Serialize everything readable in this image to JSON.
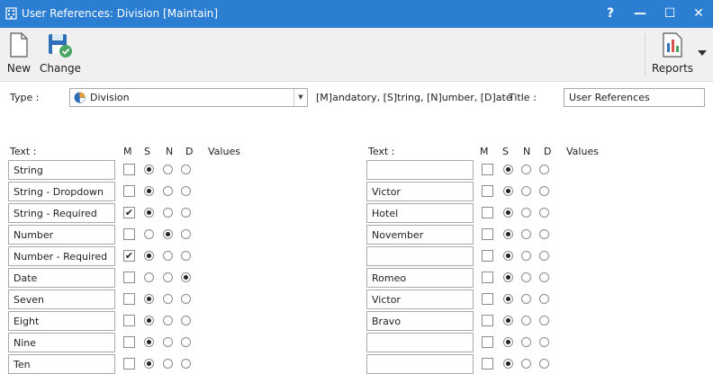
{
  "window": {
    "title": "User References: Division [Maintain]",
    "help_label": "?",
    "minimize_label": "—",
    "maximize_label": "☐",
    "close_label": "✕"
  },
  "toolbar": {
    "new_label": "New",
    "change_label": "Change",
    "reports_label": "Reports"
  },
  "form": {
    "type_label": "Type :",
    "type_value": "Division",
    "hint": "[M]andatory, [S]tring, [N]umber, [D]ate",
    "title_label": "Title :",
    "title_value": "User References"
  },
  "headers": {
    "text": "Text :",
    "m": "M",
    "s": "S",
    "n": "N",
    "d": "D",
    "values": "Values"
  },
  "left_rows": [
    {
      "text": "String",
      "mandatory": false,
      "kind": "S"
    },
    {
      "text": "String - Dropdown",
      "mandatory": false,
      "kind": "S"
    },
    {
      "text": "String - Required",
      "mandatory": true,
      "kind": "S"
    },
    {
      "text": "Number",
      "mandatory": false,
      "kind": "N"
    },
    {
      "text": "Number - Required",
      "mandatory": true,
      "kind": "S"
    },
    {
      "text": "Date",
      "mandatory": false,
      "kind": "D"
    },
    {
      "text": "Seven",
      "mandatory": false,
      "kind": "S"
    },
    {
      "text": "Eight",
      "mandatory": false,
      "kind": "S"
    },
    {
      "text": "Nine",
      "mandatory": false,
      "kind": "S"
    },
    {
      "text": "Ten",
      "mandatory": false,
      "kind": "S"
    }
  ],
  "right_rows": [
    {
      "text": "",
      "mandatory": false,
      "kind": "S"
    },
    {
      "text": "Victor",
      "mandatory": false,
      "kind": "S"
    },
    {
      "text": "Hotel",
      "mandatory": false,
      "kind": "S"
    },
    {
      "text": "November",
      "mandatory": false,
      "kind": "S"
    },
    {
      "text": "",
      "mandatory": false,
      "kind": "S"
    },
    {
      "text": "Romeo",
      "mandatory": false,
      "kind": "S"
    },
    {
      "text": "Victor",
      "mandatory": false,
      "kind": "S"
    },
    {
      "text": "Bravo",
      "mandatory": false,
      "kind": "S"
    },
    {
      "text": "",
      "mandatory": false,
      "kind": "S"
    },
    {
      "text": "",
      "mandatory": false,
      "kind": "S"
    }
  ],
  "checkmark_glyph": "✔",
  "icons": [
    "building-icon",
    "new-document-icon",
    "save-change-icon",
    "reports-icon",
    "pie-chart-icon",
    "dropdown-arrow-icon"
  ],
  "colors": {
    "titlebar": "#2b7ed2",
    "accent_check": "#4aa564"
  }
}
